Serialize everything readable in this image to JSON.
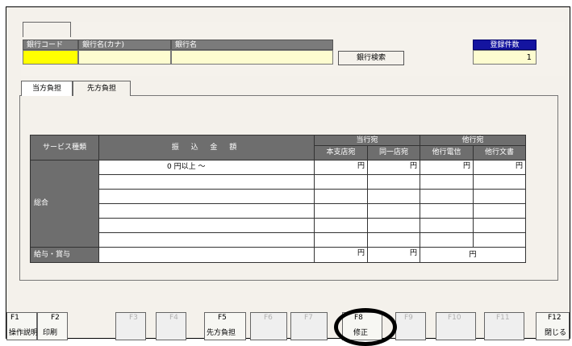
{
  "search": {
    "bank_code_header": "銀行コード",
    "bank_name_kana_header": "銀行名(カナ)",
    "bank_name_header": "銀行名",
    "bank_code_value": "",
    "bank_name_kana_value": "",
    "bank_name_value": "",
    "search_button": "銀行検索",
    "registered_count_label": "登録件数",
    "registered_count_value": "1"
  },
  "tabs": [
    {
      "label": "当方負担",
      "active": true
    },
    {
      "label": "先方負担",
      "active": false
    }
  ],
  "table": {
    "service_type_header": "サービス種類",
    "amount_header": "振 込 金 額",
    "own_bank_header": "当行宛",
    "other_bank_header": "他行宛",
    "sub_headers": [
      "本支店宛",
      "同一店宛",
      "他行電信",
      "他行文書"
    ],
    "general_label": "総合",
    "salary_label": "給与・賞与",
    "first_row_amount": "0 円以上 〜",
    "yen": "円"
  },
  "function_keys": [
    {
      "key": "F1",
      "label": "操作説明",
      "enabled": true
    },
    {
      "key": "F2",
      "label": "印刷",
      "enabled": true
    },
    {
      "key": "F3",
      "label": "",
      "enabled": false
    },
    {
      "key": "F4",
      "label": "",
      "enabled": false
    },
    {
      "key": "F5",
      "label": "先方負担",
      "enabled": true
    },
    {
      "key": "F6",
      "label": "",
      "enabled": false
    },
    {
      "key": "F7",
      "label": "",
      "enabled": false
    },
    {
      "key": "F8",
      "label": "修正",
      "enabled": true
    },
    {
      "key": "F9",
      "label": "",
      "enabled": false
    },
    {
      "key": "F10",
      "label": "",
      "enabled": false
    },
    {
      "key": "F11",
      "label": "",
      "enabled": false
    },
    {
      "key": "F12",
      "label": "閉じる",
      "enabled": true
    }
  ],
  "colors": {
    "field_bg": "#fdfcd0",
    "highlight_field": "#ffff00",
    "header_gray": "#7b7b7b",
    "count_label_blue": "#1414a0"
  }
}
